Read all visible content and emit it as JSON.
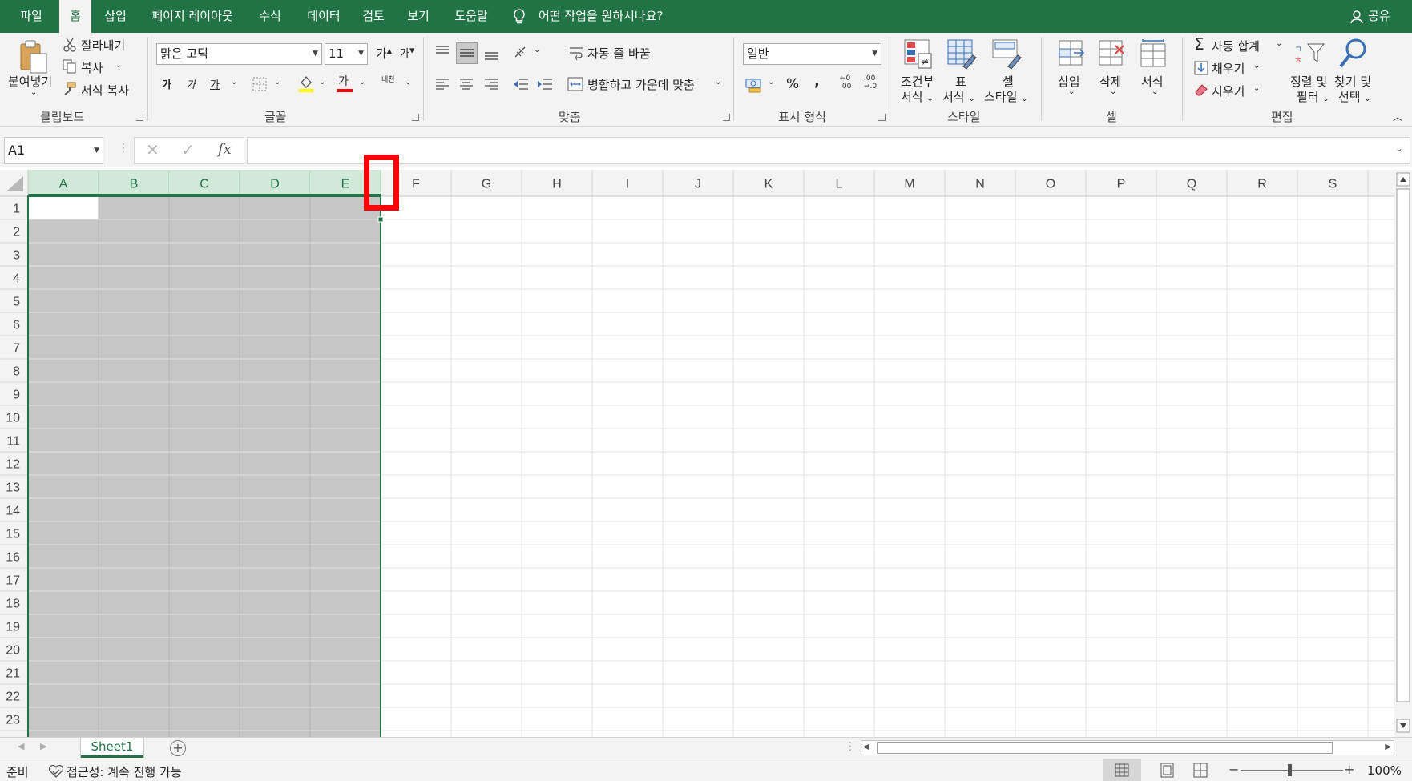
{
  "tabs": [
    {
      "label": "파일",
      "active": false
    },
    {
      "label": "홈",
      "active": true
    },
    {
      "label": "삽입",
      "active": false
    },
    {
      "label": "페이지 레이아웃",
      "active": false
    },
    {
      "label": "수식",
      "active": false
    },
    {
      "label": "데이터",
      "active": false
    },
    {
      "label": "검토",
      "active": false
    },
    {
      "label": "보기",
      "active": false
    },
    {
      "label": "도움말",
      "active": false
    }
  ],
  "tell_me": "어떤 작업을 원하시나요?",
  "share": "공유",
  "clipboard": {
    "paste": "붙여넣기",
    "cut": "잘라내기",
    "copy": "복사",
    "format_painter": "서식 복사",
    "group": "클립보드"
  },
  "font": {
    "name": "맑은 고딕",
    "size": "11",
    "grow": "가",
    "shrink": "가",
    "bold": "가",
    "italic": "가",
    "underline": "가",
    "font_color": "가",
    "phonetic": "내천",
    "group": "글꼴"
  },
  "alignment": {
    "wrap": "자동 줄 바꿈",
    "merge": "병합하고 가운데 맞춤",
    "group": "맞춤"
  },
  "number": {
    "format": "일반",
    "percent": "%",
    "comma": ",",
    "inc_decimal_top": "←0",
    "inc_decimal_bottom": ".00",
    "dec_decimal_top": ".00",
    "dec_decimal_bottom": "→.0",
    "group": "표시 형식"
  },
  "styles": {
    "cond_line1": "조건부",
    "cond_line2": "서식",
    "table_line1": "표",
    "table_line2": "서식",
    "cell_line1": "셀",
    "cell_line2": "스타일",
    "group": "스타일"
  },
  "cells": {
    "insert": "삽입",
    "delete": "삭제",
    "format": "서식",
    "group": "셀"
  },
  "editing": {
    "autosum": "자동 합계",
    "fill": "채우기",
    "clear": "지우기",
    "sort_line1": "정렬 및",
    "sort_line2": "필터",
    "find_line1": "찾기 및",
    "find_line2": "선택",
    "group": "편집"
  },
  "formula_bar": {
    "name_box": "A1",
    "fx": "fx",
    "formula": ""
  },
  "grid": {
    "columns": [
      "A",
      "B",
      "C",
      "D",
      "E",
      "F",
      "G",
      "H",
      "I",
      "J",
      "K",
      "L",
      "M",
      "N",
      "O",
      "P",
      "Q",
      "R",
      "S"
    ],
    "rows": [
      "1",
      "2",
      "3",
      "4",
      "5",
      "6",
      "7",
      "8",
      "9",
      "10",
      "11",
      "12",
      "13",
      "14",
      "15",
      "16",
      "17",
      "18",
      "19",
      "20",
      "21",
      "22",
      "23"
    ],
    "selected_columns": [
      "A",
      "B",
      "C",
      "D",
      "E"
    ],
    "active_cell": "A1"
  },
  "sheets": [
    {
      "label": "Sheet1",
      "active": true
    }
  ],
  "status": {
    "ready": "준비",
    "accessibility": "접근성: 계속 진행 가능",
    "zoom": "100%",
    "zoom_minus": "−",
    "zoom_plus": "+"
  },
  "colors": {
    "brand": "#217346",
    "highlight_box": "#ff0000",
    "selection_fill": "#c6c6c6",
    "selected_header": "#d2e8d9"
  }
}
